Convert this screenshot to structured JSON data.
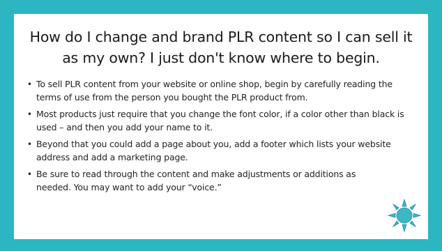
{
  "slide": {
    "title_line1": "How do I change and brand PLR content so I can sell it",
    "title_line2": "as my own? I just don't know where to begin.",
    "bullets": [
      {
        "text": "To sell PLR content from your website or online shop, begin by carefully reading the terms of use from the person you bought the PLR product from."
      },
      {
        "text": "Most products just require that you change the font color, if a color other than black is used – and then you add your name to it."
      },
      {
        "text": "Beyond that you could add a page about you, add a footer which lists your website address and add a marketing page."
      },
      {
        "text": "Be sure to read through the content and make adjustments or additions as needed. You may want to add your “voice.”"
      }
    ],
    "bullet_glyph": "•",
    "sun_icon": "sun-icon"
  },
  "colors": {
    "frame": "#2bb6c2",
    "card": "#ffffff",
    "text": "#222222",
    "sun_fill": "#3fb6c4"
  }
}
